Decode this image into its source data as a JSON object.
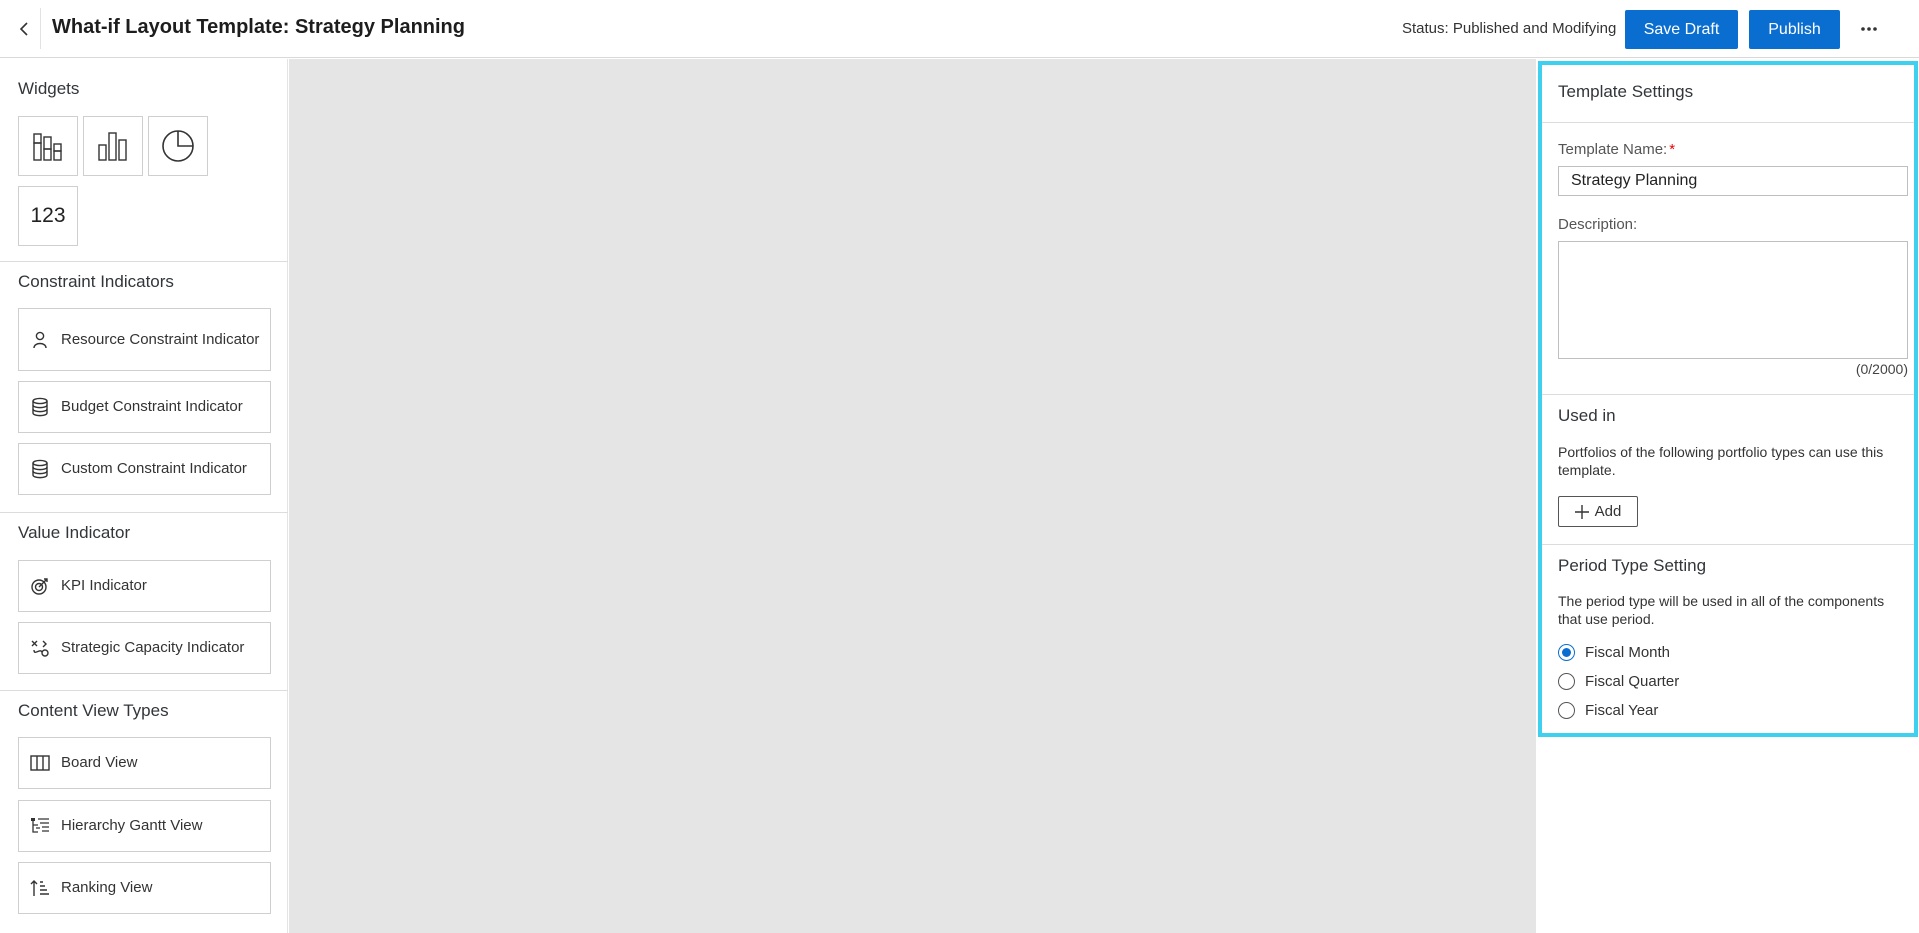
{
  "header": {
    "title": "What-if Layout Template: Strategy Planning",
    "status": "Status: Published and Modifying",
    "save_draft_label": "Save Draft",
    "publish_label": "Publish",
    "accent_color": "#0a6ed1"
  },
  "sidebar": {
    "widgets_title": "Widgets",
    "widgets": [
      {
        "icon": "grouped-bar-chart-icon"
      },
      {
        "icon": "bar-chart-icon"
      },
      {
        "icon": "pie-chart-icon"
      },
      {
        "icon": "numeric-icon",
        "text": "123"
      }
    ],
    "constraint_title": "Constraint Indicators",
    "constraint_items": [
      {
        "label": "Resource Constraint Indicator",
        "icon": "person-icon"
      },
      {
        "label": "Budget Constraint Indicator",
        "icon": "database-icon"
      },
      {
        "label": "Custom Constraint Indicator",
        "icon": "database-icon"
      }
    ],
    "value_title": "Value Indicator",
    "value_items": [
      {
        "label": "KPI Indicator",
        "icon": "target-icon"
      },
      {
        "label": "Strategic Capacity Indicator",
        "icon": "strategy-icon"
      }
    ],
    "content_title": "Content View Types",
    "content_items": [
      {
        "label": "Board View",
        "icon": "board-icon"
      },
      {
        "label": "Hierarchy Gantt View",
        "icon": "hierarchy-icon"
      },
      {
        "label": "Ranking View",
        "icon": "ranking-icon"
      }
    ]
  },
  "settings": {
    "title": "Template Settings",
    "name_label": "Template Name:",
    "required_mark": "*",
    "name_value": "Strategy Planning",
    "description_label": "Description:",
    "description_value": "",
    "description_counter": "(0/2000)",
    "used_in_title": "Used in",
    "used_in_text": "Portfolios of the following portfolio types can use this template.",
    "add_label": "Add",
    "period_title": "Period Type Setting",
    "period_text": "The period type will be used in all of the components that use period.",
    "period_options": [
      {
        "label": "Fiscal Month",
        "selected": true
      },
      {
        "label": "Fiscal Quarter",
        "selected": false
      },
      {
        "label": "Fiscal Year",
        "selected": false
      }
    ],
    "highlight_color": "#3fd0f0"
  }
}
